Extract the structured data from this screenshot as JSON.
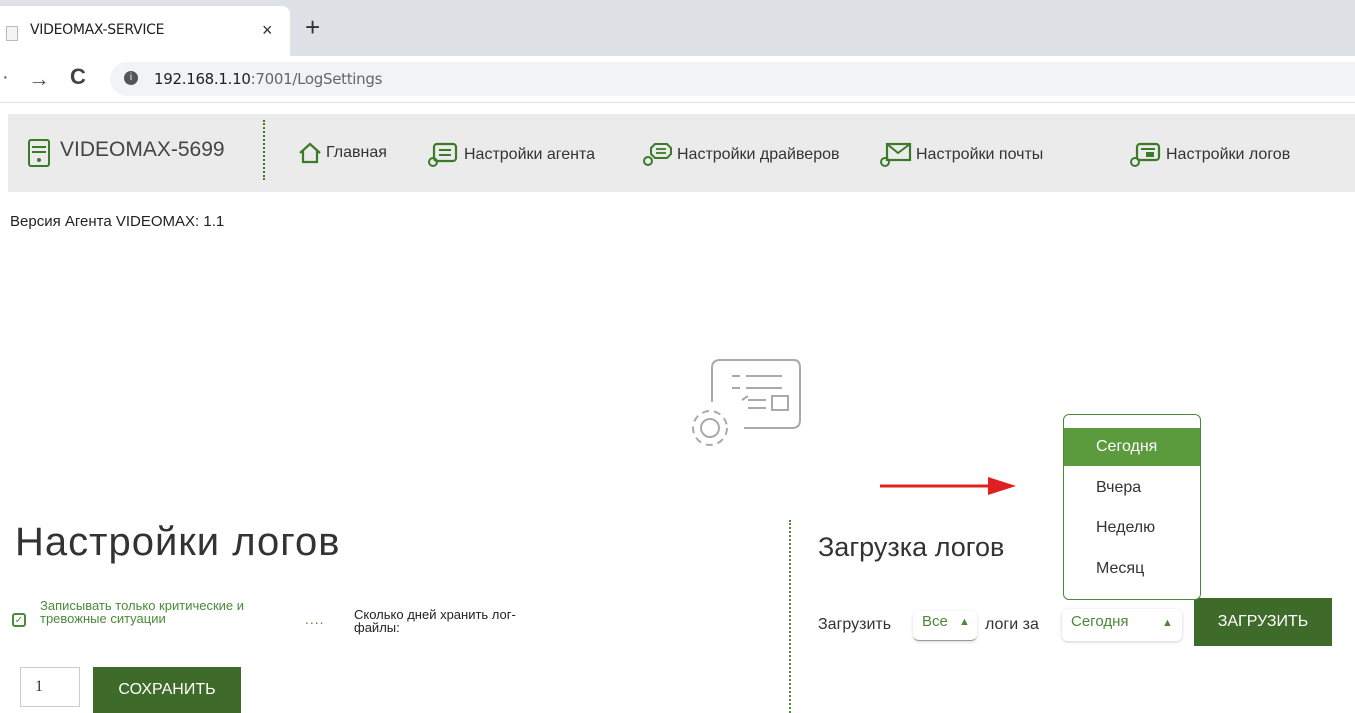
{
  "browser": {
    "tab_title": "VIDEOMAX-SERVICE",
    "tab_close": "×",
    "new_tab": "+",
    "url_host": "192.168.1.10",
    "url_path": ":7001/LogSettings"
  },
  "nav": {
    "brand_prefix": "VIDEOMAX",
    "brand_suffix": "-5699",
    "items": [
      {
        "label": "Главная",
        "icon": "home-icon"
      },
      {
        "label": "Настройки агента",
        "icon": "agent-settings-icon"
      },
      {
        "label": "Настройки драйверов",
        "icon": "driver-settings-icon"
      },
      {
        "label": "Настройки почты",
        "icon": "mail-settings-icon"
      },
      {
        "label": "Настройки логов",
        "icon": "log-settings-icon"
      }
    ]
  },
  "version_text": "Версия Агента VIDEOMAX: 1.1",
  "log_settings": {
    "title": "Настройки логов",
    "checkbox_label": "Записывать только критические и тревожные ситуации",
    "checkbox_checked": true,
    "dots": "....",
    "days_label": "Сколько дней хранить лог-файлы:",
    "days_value": "1",
    "save_label": "СОХРАНИТЬ"
  },
  "log_download": {
    "title": "Загрузка логов",
    "load_label": "Загрузить",
    "type_selected": "Все",
    "logs_for_label": "логи за",
    "period_selected": "Сегодня",
    "button_label": "ЗАГРУЗИТЬ",
    "period_options": [
      "Сегодня",
      "Вчера",
      "Неделю",
      "Месяц"
    ]
  },
  "colors": {
    "accent": "#4a8a38",
    "button": "#3e6b2a",
    "selected_option": "#5b9a3d",
    "arrow": "#e02020"
  }
}
